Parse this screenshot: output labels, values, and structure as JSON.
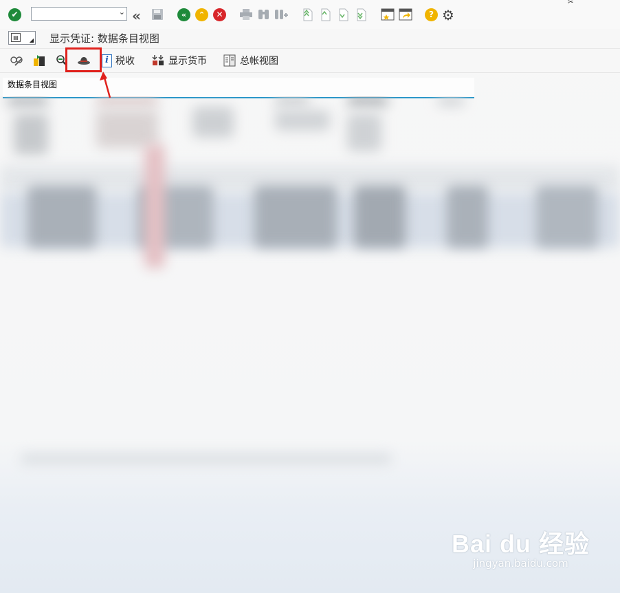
{
  "toolbar": {
    "command_field_value": "",
    "icons": [
      "enter-check-icon",
      "back-double-chevron-icon",
      "save-icon",
      "back-icon",
      "exit-icon",
      "cancel-icon",
      "print-icon",
      "find-icon",
      "find-next-icon",
      "first-page-icon",
      "previous-page-icon",
      "next-page-icon",
      "last-page-icon",
      "new-session-icon",
      "shortcut-icon",
      "help-icon",
      "settings-gear-icon"
    ]
  },
  "title_bar": {
    "title": "显示凭证: 数据条目视图"
  },
  "app_toolbar": {
    "items": [
      {
        "label": "",
        "icon": "display-change-icon"
      },
      {
        "label": "",
        "icon": "other-document-icon"
      },
      {
        "label": "",
        "icon": "zoom-document-icon"
      },
      {
        "label": "",
        "icon": "hat-icon"
      },
      {
        "label": "税收",
        "icon": "info-icon"
      },
      {
        "label": "显示货币",
        "icon": "currency-icon"
      },
      {
        "label": "总帐视图",
        "icon": "ledger-view-icon"
      }
    ]
  },
  "panel": {
    "title": "数据条目视图"
  },
  "watermark": {
    "main": "Bai du 经验",
    "sub": "jingyan.baidu.com"
  },
  "colors": {
    "accent_blue": "#2a97c9",
    "highlight_red": "#e0211c",
    "ok_green": "#1e8a3a",
    "warn_yellow": "#f0b400",
    "cancel_red": "#d8262a"
  }
}
